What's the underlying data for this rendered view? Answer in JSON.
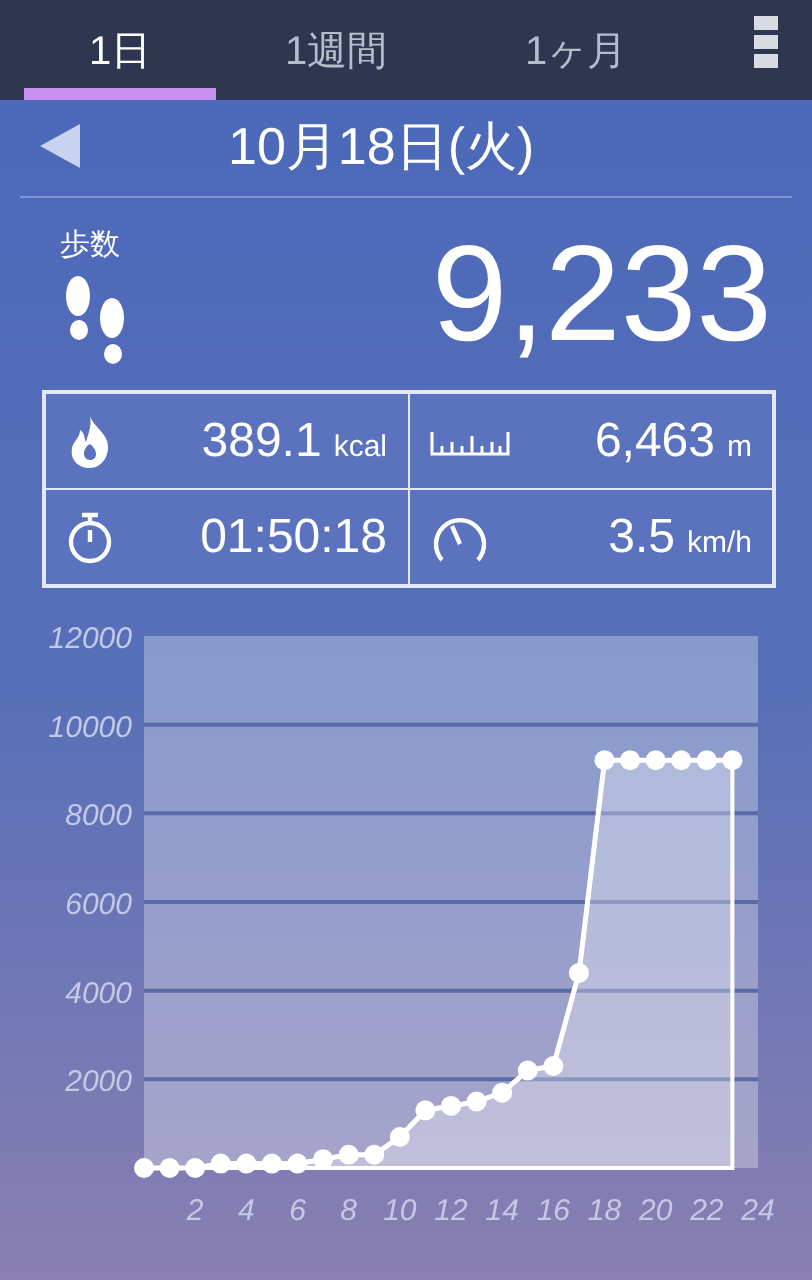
{
  "tabs": [
    {
      "label": "1日",
      "selected": true
    },
    {
      "label": "1週間",
      "selected": false
    },
    {
      "label": "1ヶ月",
      "selected": false
    }
  ],
  "date": "10月18日(火)",
  "steps": {
    "label": "歩数",
    "value": "9,233"
  },
  "stats": [
    {
      "kind": "calories",
      "value": "389.1",
      "unit": "kcal"
    },
    {
      "kind": "distance",
      "value": "6,463",
      "unit": "m"
    },
    {
      "kind": "duration",
      "value": "01:50:18"
    },
    {
      "kind": "speed",
      "value": "3.5",
      "unit": "km/h"
    }
  ],
  "chart_data": {
    "type": "area",
    "x": [
      0,
      1,
      2,
      3,
      4,
      5,
      6,
      7,
      8,
      9,
      10,
      11,
      12,
      13,
      14,
      15,
      16,
      17,
      18,
      19,
      20,
      21,
      22,
      23
    ],
    "values": [
      0,
      0,
      0,
      100,
      100,
      100,
      100,
      200,
      300,
      300,
      700,
      1300,
      1400,
      1500,
      1700,
      2200,
      2300,
      4400,
      9200,
      9200,
      9200,
      9200,
      9200,
      9200
    ],
    "grid": true,
    "xlim": [
      0,
      24
    ],
    "ylim": [
      0,
      12000
    ],
    "xticks": [
      2,
      4,
      6,
      8,
      10,
      12,
      14,
      16,
      18,
      20,
      22,
      24
    ],
    "yticks": [
      2000,
      4000,
      6000,
      8000,
      10000,
      12000
    ]
  }
}
